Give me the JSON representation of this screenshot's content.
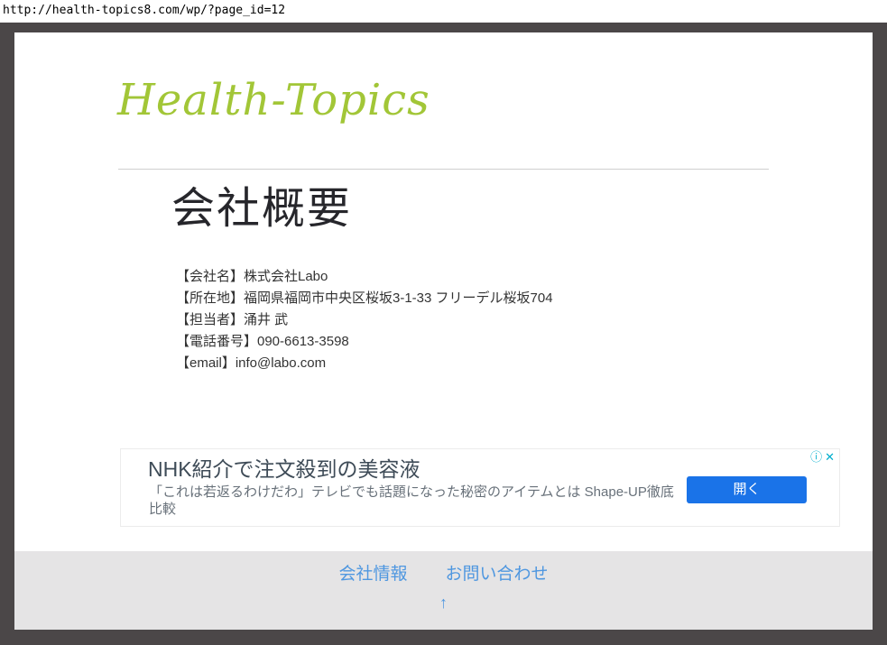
{
  "browser": {
    "url": "http://health-topics8.com/wp/?page_id=12"
  },
  "site": {
    "logo_text": "Health-Topics",
    "logo_color": "#a2c637",
    "frame_color": "#4b4748"
  },
  "page": {
    "title": "会社概要",
    "details": [
      "【会社名】株式会社Labo",
      "【所在地】福岡県福岡市中央区桜坂3-1-33 フリーデル桜坂704",
      "【担当者】涌井 武",
      "【電話番号】090-6613-3598",
      "【email】info@labo.com"
    ]
  },
  "ad": {
    "title": "NHK紹介で注文殺到の美容液",
    "description": "「これは若返るわけだわ」テレビでも話題になった秘密のアイテムとは Shape-UP徹底比較",
    "button_label": "開く",
    "button_color": "#1a73e8",
    "info_icon": "ⓘ",
    "close_icon": "✕",
    "icon_color": "#00aecd"
  },
  "footer": {
    "links": [
      {
        "label": "会社情報"
      },
      {
        "label": "お問い合わせ"
      }
    ],
    "back_to_top_label": "↑",
    "link_color": "#4f97e0",
    "background_color": "#e5e4e5"
  }
}
